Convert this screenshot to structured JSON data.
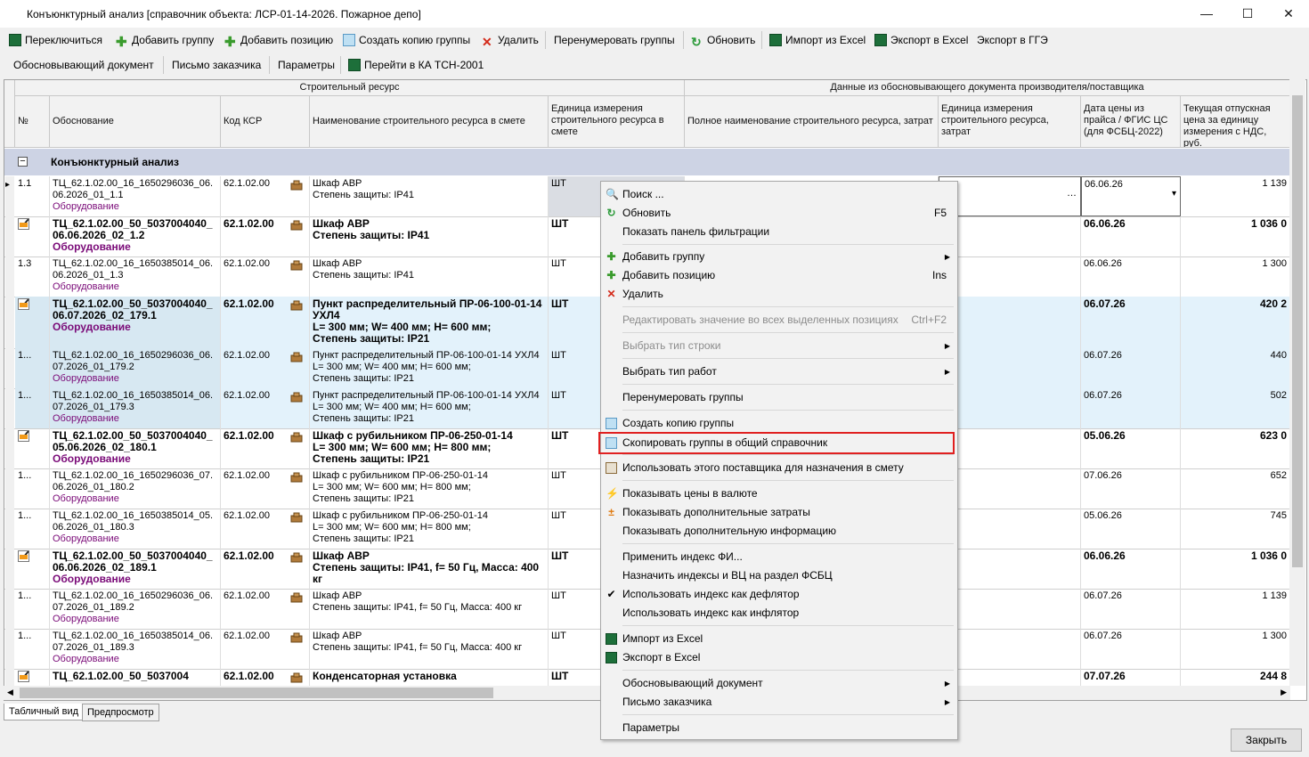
{
  "window": {
    "title": "Конъюнктурный анализ [справочник объекта: ЛСР-01-14-2026. Пожарное депо]",
    "minimize": "—",
    "maximize": "☐",
    "close": "✕"
  },
  "toolbar1": {
    "switch": "Переключиться",
    "add_group": "Добавить группу",
    "add_position": "Добавить позицию",
    "copy_groups": "Создать копию группы",
    "delete": "Удалить",
    "renumber": "Перенумеровать группы",
    "refresh": "Обновить",
    "import_excel": "Импорт из Excel",
    "export_excel": "Экспорт в Excel",
    "export_gge": "Экспорт в ГГЭ"
  },
  "toolbar2": {
    "doc": "Обосновывающий документ",
    "letter": "Письмо заказчика",
    "params": "Параметры",
    "goto": "Перейти в КА ТСН-2001"
  },
  "grid": {
    "group_header_left": "Строительный ресурс",
    "group_header_right": "Данные из обосновывающего документа производителя/поставщика",
    "columns": {
      "num": "№",
      "basis": "Обоснование",
      "ksr": "Код КСР",
      "name": "Наименование строительного ресурса в смете",
      "unit": "Единица измерения строительного ресурса в смете",
      "full_name": "Полное наименование строительного ресурса, затрат",
      "unit2": "Единица измерения строительного ресурса, затрат",
      "date": "Дата цены из прайса / ФГИС ЦС (для ФСБЦ-2022)",
      "price": "Текущая отпускная цена за единицу измерения с НДС, руб."
    },
    "group_label": "Конъюнктурный анализ",
    "rows": [
      {
        "num": "1.1",
        "basis": "ТЦ_62.1.02.00_16_1650296036_06.06.2026_01_1.1",
        "cat": "Оборудование",
        "ksr": "62.1.02.00",
        "name": "Шкаф АВР\nСтепень защиты: IP41",
        "unit": "ШТ",
        "date": "06.06.26",
        "price": "1 139"
      },
      {
        "num": "",
        "basis": "ТЦ_62.1.02.00_50_5037004040_06.06.2026_02_1.2",
        "cat": "Оборудование",
        "ksr": "62.1.02.00",
        "name": "Шкаф АВР\nСтепень защиты: IP41",
        "unit": "ШТ",
        "date": "06.06.26",
        "price": "1 036 0"
      },
      {
        "num": "1.3",
        "basis": "ТЦ_62.1.02.00_16_1650385014_06.06.2026_01_1.3",
        "cat": "Оборудование",
        "ksr": "62.1.02.00",
        "name": "Шкаф АВР\nСтепень защиты: IP41",
        "unit": "ШТ",
        "date": "06.06.26",
        "price": "1 300"
      },
      {
        "num": "",
        "basis": "ТЦ_62.1.02.00_50_5037004040_06.07.2026_02_179.1",
        "cat": "Оборудование",
        "ksr": "62.1.02.00",
        "name": "Пункт распределительный ПР-06-100-01-14 УХЛ4\nL= 300 мм; W= 400 мм; H= 600 мм;\nСтепень защиты: IP21",
        "unit": "ШТ",
        "date": "06.07.26",
        "price": "420 2"
      },
      {
        "num": "1...",
        "basis": "ТЦ_62.1.02.00_16_1650296036_06.07.2026_01_179.2",
        "cat": "Оборудование",
        "ksr": "62.1.02.00",
        "name": "Пункт распределительный ПР-06-100-01-14 УХЛ4\nL= 300 мм; W= 400 мм; H= 600 мм;\nСтепень защиты: IP21",
        "unit": "ШТ",
        "date": "06.07.26",
        "price": "440"
      },
      {
        "num": "1...",
        "basis": "ТЦ_62.1.02.00_16_1650385014_06.07.2026_01_179.3",
        "cat": "Оборудование",
        "ksr": "62.1.02.00",
        "name": "Пункт распределительный ПР-06-100-01-14 УХЛ4\nL= 300 мм; W= 400 мм; H= 600 мм;\nСтепень защиты: IP21",
        "unit": "ШТ",
        "date": "06.07.26",
        "price": "502"
      },
      {
        "num": "",
        "basis": "ТЦ_62.1.02.00_50_5037004040_05.06.2026_02_180.1",
        "cat": "Оборудование",
        "ksr": "62.1.02.00",
        "name": "Шкаф с рубильником ПР-06-250-01-14\nL= 300 мм; W= 600 мм; H= 800 мм;\nСтепень защиты: IP21",
        "unit": "ШТ",
        "date": "05.06.26",
        "price": "623 0"
      },
      {
        "num": "1...",
        "basis": "ТЦ_62.1.02.00_16_1650296036_07.06.2026_01_180.2",
        "cat": "Оборудование",
        "ksr": "62.1.02.00",
        "name": "Шкаф с рубильником ПР-06-250-01-14\nL= 300 мм; W= 600 мм; H= 800 мм;\nСтепень защиты: IP21",
        "unit": "ШТ",
        "date": "07.06.26",
        "price": "652"
      },
      {
        "num": "1...",
        "basis": "ТЦ_62.1.02.00_16_1650385014_05.06.2026_01_180.3",
        "cat": "Оборудование",
        "ksr": "62.1.02.00",
        "name": "Шкаф с рубильником ПР-06-250-01-14\nL= 300 мм; W= 600 мм; H= 800 мм;\nСтепень защиты: IP21",
        "unit": "ШТ",
        "date": "05.06.26",
        "price": "745"
      },
      {
        "num": "",
        "basis": "ТЦ_62.1.02.00_50_5037004040_06.06.2026_02_189.1",
        "cat": "Оборудование",
        "ksr": "62.1.02.00",
        "name": "Шкаф АВР\nСтепень защиты: IP41, f= 50 Гц, Масса: 400 кг",
        "unit": "ШТ",
        "date": "06.06.26",
        "price": "1 036 0"
      },
      {
        "num": "1...",
        "basis": "ТЦ_62.1.02.00_16_1650296036_06.07.2026_01_189.2",
        "cat": "Оборудование",
        "ksr": "62.1.02.00",
        "name": "Шкаф АВР\nСтепень защиты: IP41, f= 50 Гц, Масса: 400 кг",
        "unit": "ШТ",
        "date": "06.07.26",
        "price": "1 139"
      },
      {
        "num": "1...",
        "basis": "ТЦ_62.1.02.00_16_1650385014_06.07.2026_01_189.3",
        "cat": "Оборудование",
        "ksr": "62.1.02.00",
        "name": "Шкаф АВР\nСтепень защиты: IP41, f= 50 Гц, Масса: 400 кг",
        "unit": "ШТ",
        "date": "06.07.26",
        "price": "1 300"
      },
      {
        "num": "",
        "basis": "ТЦ_62.1.02.00_50_5037004",
        "cat": "",
        "ksr": "62.1.02.00",
        "name": "Конденсаторная установка",
        "unit": "ШТ",
        "date": "07.07.26",
        "price": "244 8"
      }
    ]
  },
  "context_menu": {
    "search": "Поиск ...",
    "refresh": "Обновить",
    "refresh_sc": "F5",
    "show_filter": "Показать панель фильтрации",
    "add_group": "Добавить группу",
    "add_position": "Добавить позицию",
    "add_position_sc": "Ins",
    "delete": "Удалить",
    "edit_all": "Редактировать значение во всех выделенных позициях",
    "edit_all_sc": "Ctrl+F2",
    "row_type": "Выбрать тип строки",
    "work_type": "Выбрать тип работ",
    "renumber": "Перенумеровать группы",
    "copy_group": "Создать копию группы",
    "copy_to_common": "Скопировать группы в общий справочник",
    "use_supplier": "Использовать этого поставщика для назначения в смету",
    "currency": "Показывать цены в валюте",
    "extra_costs": "Показывать дополнительные затраты",
    "extra_info": "Показывать дополнительную информацию",
    "apply_index": "Применить индекс ФИ...",
    "assign_index": "Назначить индексы и ВЦ на раздел ФСБЦ",
    "deflator": "Использовать индекс как дефлятор",
    "inflator": "Использовать индекс как инфлятор",
    "import_excel": "Импорт из Excel",
    "export_excel": "Экспорт в Excel",
    "doc": "Обосновывающий документ",
    "letter": "Письмо заказчика",
    "params": "Параметры"
  },
  "tabs": {
    "table": "Табличный вид",
    "preview": "Предпросмотр"
  },
  "close_button": "Закрыть",
  "colors": {
    "accent_highlight": "#e02020",
    "group_band": "#cdd3e4",
    "row_blue": "#e3f2fb",
    "category": "#7a0a78"
  }
}
